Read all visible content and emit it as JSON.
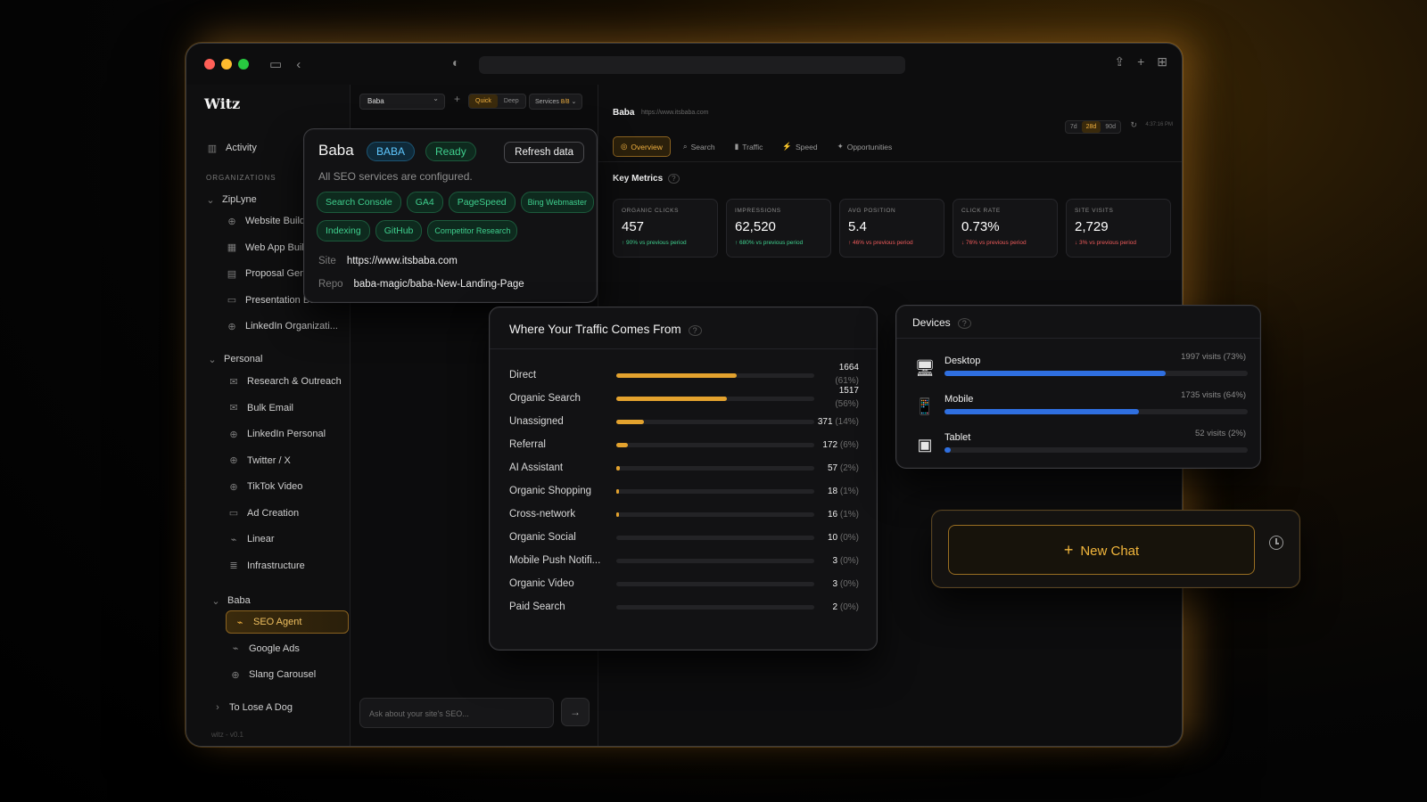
{
  "app": {
    "brand": "Witz",
    "version": "witz - v0.1"
  },
  "sidebar": {
    "activity_label": "Activity",
    "org_heading": "ORGANIZATIONS",
    "groups": [
      {
        "label": "ZipLyne",
        "items": [
          {
            "label": "Website Build",
            "icon": "globe-icon"
          },
          {
            "label": "Web App Buil",
            "icon": "grid-icon"
          },
          {
            "label": "Proposal Gen",
            "icon": "document-icon"
          },
          {
            "label": "Presentation Builder",
            "icon": "presentation-icon"
          },
          {
            "label": "LinkedIn Organizati...",
            "icon": "globe-icon"
          }
        ]
      },
      {
        "label": "Personal",
        "items": [
          {
            "label": "Research & Outreach",
            "icon": "mail-icon"
          },
          {
            "label": "Bulk Email",
            "icon": "mail-icon"
          },
          {
            "label": "LinkedIn Personal",
            "icon": "globe-icon"
          },
          {
            "label": "Twitter / X",
            "icon": "globe-icon"
          },
          {
            "label": "TikTok Video",
            "icon": "globe-icon"
          },
          {
            "label": "Ad Creation",
            "icon": "presentation-icon"
          },
          {
            "label": "Linear",
            "icon": "chart-icon"
          },
          {
            "label": "Infrastructure",
            "icon": "server-icon"
          }
        ]
      },
      {
        "label": "Baba",
        "items": [
          {
            "label": "SEO Agent",
            "icon": "chart-icon",
            "active": true
          },
          {
            "label": "Google Ads",
            "icon": "chart-icon"
          },
          {
            "label": "Slang Carousel",
            "icon": "globe-icon"
          }
        ]
      },
      {
        "label": "To Lose A Dog",
        "collapsed": true,
        "items": []
      }
    ]
  },
  "midcol": {
    "project_select": "Baba",
    "mode_quick": "Quick",
    "mode_deep": "Deep",
    "services_label": "Services",
    "services_count": "8/8",
    "chat_placeholder": "Ask about your site's SEO..."
  },
  "main": {
    "site_name": "Baba",
    "site_url": "https://www.itsbaba.com",
    "ranges": [
      "7d",
      "28d",
      "90d"
    ],
    "active_range": "28d",
    "time": "4:37:16 PM",
    "tabs": [
      {
        "label": "Overview",
        "icon": "target-icon",
        "active": true
      },
      {
        "label": "Search",
        "icon": "search-icon"
      },
      {
        "label": "Traffic",
        "icon": "bar-chart-icon"
      },
      {
        "label": "Speed",
        "icon": "bolt-icon"
      },
      {
        "label": "Opportunities",
        "icon": "spark-icon"
      }
    ],
    "key_metrics_title": "Key Metrics",
    "metrics": [
      {
        "label": "ORGANIC CLICKS",
        "value": "457",
        "change": "↑ 90% vs previous period",
        "direction": "up"
      },
      {
        "label": "IMPRESSIONS",
        "value": "62,520",
        "change": "↑ 680% vs previous period",
        "direction": "up"
      },
      {
        "label": "AVG POSITION",
        "value": "5.4",
        "change": "↑ 46% vs previous period",
        "direction": "down"
      },
      {
        "label": "CLICK RATE",
        "value": "0.73%",
        "change": "↓ 76% vs previous period",
        "direction": "down"
      },
      {
        "label": "SITE VISITS",
        "value": "2,729",
        "change": "↓ 3% vs previous period",
        "direction": "down"
      }
    ]
  },
  "baba_card": {
    "name": "Baba",
    "tag": "BABA",
    "status": "Ready",
    "refresh_label": "Refresh data",
    "description": "All SEO services are configured.",
    "services_row1": [
      "Search Console",
      "GA4",
      "PageSpeed",
      "Bing Webmaster"
    ],
    "services_row2": [
      "Indexing",
      "GitHub",
      "Competitor Research"
    ],
    "site_key": "Site",
    "site_value": "https://www.itsbaba.com",
    "repo_key": "Repo",
    "repo_value": "baba-magic/baba-New-Landing-Page"
  },
  "traffic": {
    "title": "Where Your Traffic Comes From",
    "rows": [
      {
        "label": "Direct",
        "count": "1664",
        "pct": "(61%)",
        "share": 0.61,
        "stacked": true
      },
      {
        "label": "Organic Search",
        "count": "1517",
        "pct": "(56%)",
        "share": 0.56,
        "stacked": true
      },
      {
        "label": "Unassigned",
        "count": "371",
        "pct": "(14%)",
        "share": 0.14
      },
      {
        "label": "Referral",
        "count": "172",
        "pct": "(6%)",
        "share": 0.06
      },
      {
        "label": "AI Assistant",
        "count": "57",
        "pct": "(2%)",
        "share": 0.02
      },
      {
        "label": "Organic Shopping",
        "count": "18",
        "pct": "(1%)",
        "share": 0.01
      },
      {
        "label": "Cross-network",
        "count": "16",
        "pct": "(1%)",
        "share": 0.01
      },
      {
        "label": "Organic Social",
        "count": "10",
        "pct": "(0%)",
        "share": 0.0
      },
      {
        "label": "Mobile Push Notifi...",
        "count": "3",
        "pct": "(0%)",
        "share": 0.0
      },
      {
        "label": "Organic Video",
        "count": "3",
        "pct": "(0%)",
        "share": 0.0
      },
      {
        "label": "Paid Search",
        "count": "2",
        "pct": "(0%)",
        "share": 0.0
      }
    ]
  },
  "devices": {
    "title": "Devices",
    "rows": [
      {
        "label": "Desktop",
        "visits": "1997 visits (73%)",
        "share": 0.73,
        "icon": "desktop-icon"
      },
      {
        "label": "Mobile",
        "visits": "1735 visits (64%)",
        "share": 0.64,
        "icon": "mobile-icon"
      },
      {
        "label": "Tablet",
        "visits": "52 visits (2%)",
        "share": 0.02,
        "icon": "tablet-icon"
      }
    ]
  },
  "new_chat": {
    "label": "New Chat"
  },
  "colors": {
    "accent": "#f0b040",
    "bar_traffic": "#e3a22e",
    "bar_device": "#2f6fe0",
    "positive": "#3fcf8e",
    "negative": "#ef5b5b"
  }
}
